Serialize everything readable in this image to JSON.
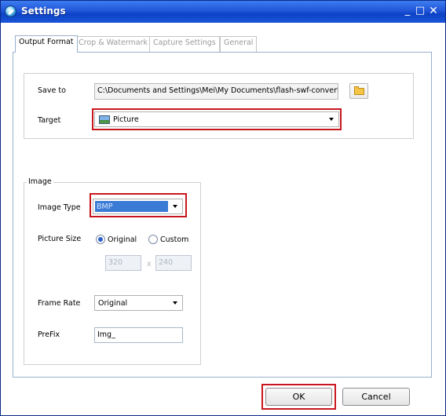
{
  "window": {
    "title": "Settings"
  },
  "tabs": [
    {
      "label": "Output Format"
    },
    {
      "label": "Crop & Watermark"
    },
    {
      "label": "Capture Settings"
    },
    {
      "label": "General"
    }
  ],
  "output": {
    "save_to_label": "Save to",
    "save_to_value": "C:\\Documents and Settings\\Mei\\My Documents\\flash-swf-convert",
    "target_label": "Target",
    "target_value": "Picture"
  },
  "image": {
    "group_label": "Image",
    "image_type_label": "Image Type",
    "image_type_value": "BMP",
    "picture_size_label": "Picture Size",
    "original_label": "Original",
    "custom_label": "Custom",
    "width_value": "320",
    "x_label": "x",
    "height_value": "240",
    "frame_rate_label": "Frame Rate",
    "frame_rate_value": "Original",
    "prefix_label": "PreFix",
    "prefix_value": "Img_"
  },
  "buttons": {
    "ok": "OK",
    "cancel": "Cancel"
  },
  "colors": {
    "highlight_border": "#c8161d",
    "selection": "#3a7bd5",
    "title_bar": "#2156d8"
  },
  "icons": {
    "app": "settings-app-icon",
    "folder": "open-folder-icon",
    "picture": "picture-icon"
  }
}
